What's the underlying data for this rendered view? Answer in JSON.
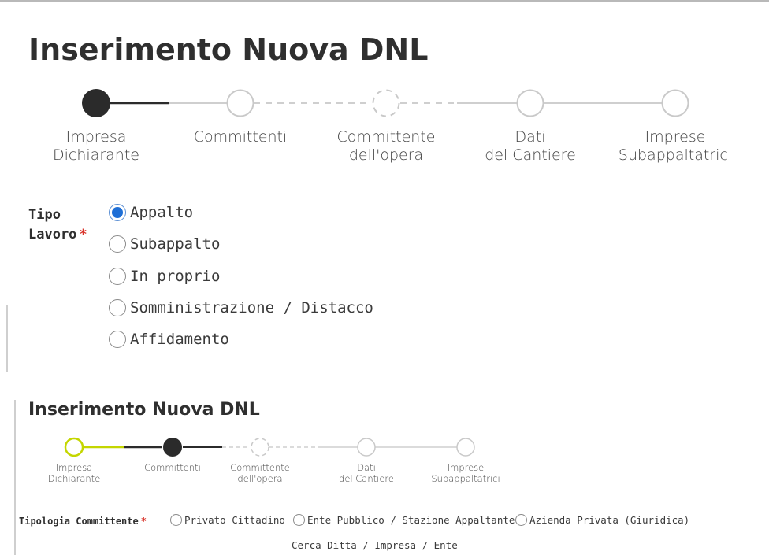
{
  "screen1": {
    "title": "Inserimento Nuova DNL",
    "steps": [
      {
        "line1": "Impresa",
        "line2": "Dichiarante",
        "state": "active"
      },
      {
        "line1": "Committenti",
        "line2": "",
        "state": "pending"
      },
      {
        "line1": "Committente",
        "line2": "dell'opera",
        "state": "dashed"
      },
      {
        "line1": "Dati",
        "line2": "del Cantiere",
        "state": "pending"
      },
      {
        "line1": "Imprese",
        "line2": "Subappaltatrici",
        "state": "pending"
      }
    ],
    "tipo_lavoro": {
      "label_line1": "Tipo",
      "label_line2": "Lavoro",
      "required_mark": "*",
      "options": [
        "Appalto",
        "Subappalto",
        "In proprio",
        "Somministrazione / Distacco",
        "Affidamento"
      ],
      "selected": "Appalto"
    }
  },
  "screen2": {
    "title": "Inserimento Nuova DNL",
    "steps": [
      {
        "line1": "Impresa",
        "line2": "Dichiarante",
        "state": "completed"
      },
      {
        "line1": "Committenti",
        "line2": "",
        "state": "active"
      },
      {
        "line1": "Committente",
        "line2": "dell'opera",
        "state": "dashed"
      },
      {
        "line1": "Dati",
        "line2": "del Cantiere",
        "state": "pending"
      },
      {
        "line1": "Imprese",
        "line2": "Subappaltatrici",
        "state": "pending"
      }
    ],
    "tipologia_committente": {
      "label": "Tipologia Committente",
      "required_mark": "*",
      "options": [
        "Privato Cittadino",
        "Ente Pubblico / Stazione Appaltante",
        "Azienda Privata (Giuridica)"
      ],
      "selected": ""
    },
    "search_label": "Cerca Ditta / Impresa / Ente"
  },
  "colors": {
    "active_step": "#2b2b2b",
    "completed_step": "#c4d600",
    "pending_step": "#c9c9c9",
    "radio_selected": "#1f6fd6",
    "required": "#d9342b"
  }
}
